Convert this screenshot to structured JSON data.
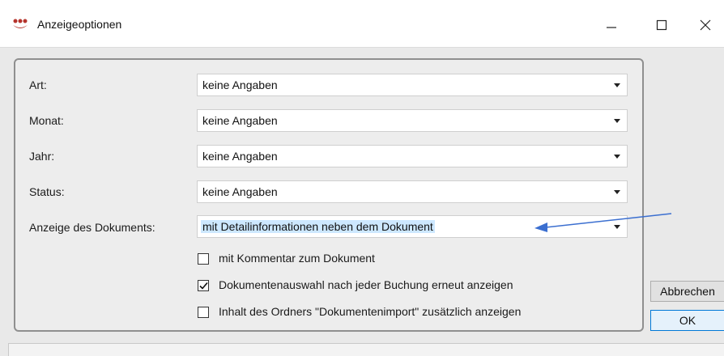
{
  "window": {
    "title": "Anzeigeoptionen",
    "icon": "app-logo-icon",
    "controls": [
      "minimize-icon",
      "maximize-icon",
      "close-icon"
    ]
  },
  "form": {
    "rows": [
      {
        "label": "Art:",
        "value": "keine Angaben"
      },
      {
        "label": "Monat:",
        "value": "keine Angaben"
      },
      {
        "label": "Jahr:",
        "value": "keine Angaben"
      },
      {
        "label": "Status:",
        "value": "keine Angaben"
      },
      {
        "label": "Anzeige des Dokuments:",
        "value": "mit Detailinformationen neben dem Dokument"
      }
    ],
    "checkboxes": [
      {
        "label": "mit Kommentar zum Dokument",
        "checked": false
      },
      {
        "label": "Dokumentenauswahl nach jeder Buchung erneut anzeigen",
        "checked": true
      },
      {
        "label": "Inhalt des Ordners \"Dokumentenimport\" zusätzlich anzeigen",
        "checked": false
      }
    ]
  },
  "buttons": {
    "cancel": "Abbrechen",
    "ok": "OK"
  },
  "colors": {
    "selection_highlight": "#cde8ff",
    "annotation_arrow": "#3b6fd0",
    "ok_border": "#0078d7"
  }
}
